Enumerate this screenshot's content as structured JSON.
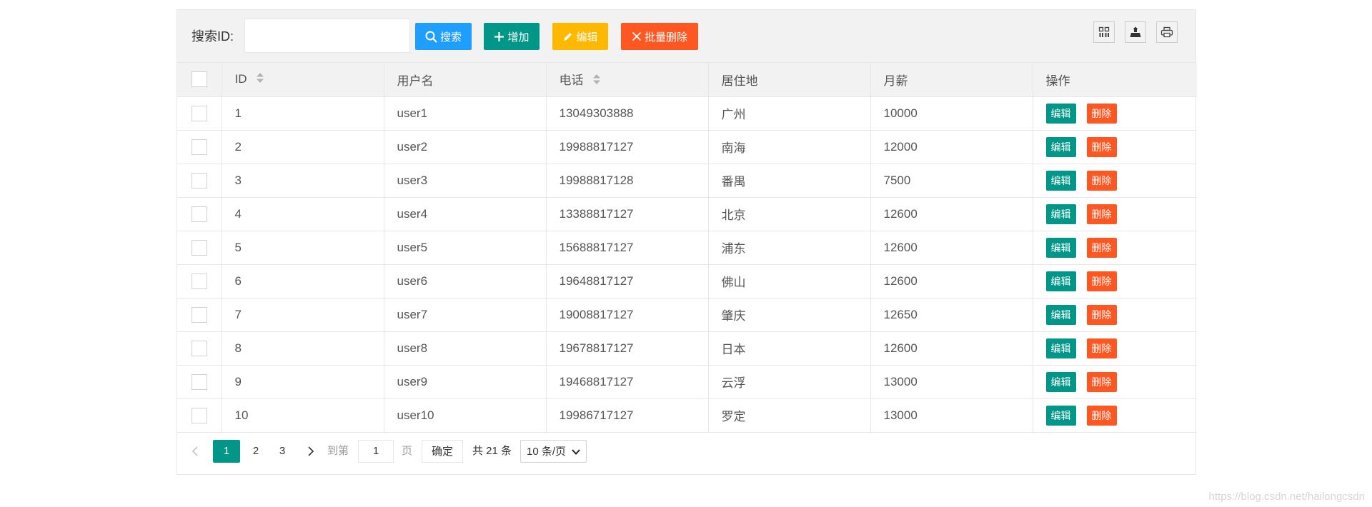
{
  "toolbar": {
    "search_label": "搜索ID:",
    "search_value": "",
    "search_button": "搜索",
    "add_button": "增加",
    "edit_button": "编辑",
    "batch_delete_button": "批量删除",
    "colors": {
      "search": "#1e9fff",
      "add": "#009688",
      "edit": "#ffb800",
      "batch_delete": "#ff5722"
    },
    "icons": [
      "columns-filter-icon",
      "export-icon",
      "print-icon"
    ]
  },
  "table": {
    "headers": {
      "id": "ID",
      "username": "用户名",
      "phone": "电话",
      "city": "居住地",
      "salary": "月薪",
      "actions": "操作"
    },
    "row_edit_label": "编辑",
    "row_delete_label": "删除",
    "rows": [
      {
        "id": "1",
        "username": "user1",
        "phone": "13049303888",
        "city": "广州",
        "salary": "10000"
      },
      {
        "id": "2",
        "username": "user2",
        "phone": "19988817127",
        "city": "南海",
        "salary": "12000"
      },
      {
        "id": "3",
        "username": "user3",
        "phone": "19988817128",
        "city": "番禺",
        "salary": "7500"
      },
      {
        "id": "4",
        "username": "user4",
        "phone": "13388817127",
        "city": "北京",
        "salary": "12600"
      },
      {
        "id": "5",
        "username": "user5",
        "phone": "15688817127",
        "city": "浦东",
        "salary": "12600"
      },
      {
        "id": "6",
        "username": "user6",
        "phone": "19648817127",
        "city": "佛山",
        "salary": "12600"
      },
      {
        "id": "7",
        "username": "user7",
        "phone": "19008817127",
        "city": "肇庆",
        "salary": "12650"
      },
      {
        "id": "8",
        "username": "user8",
        "phone": "19678817127",
        "city": "日本",
        "salary": "12600"
      },
      {
        "id": "9",
        "username": "user9",
        "phone": "19468817127",
        "city": "云浮",
        "salary": "13000"
      },
      {
        "id": "10",
        "username": "user10",
        "phone": "19986717127",
        "city": "罗定",
        "salary": "13000"
      }
    ]
  },
  "pagination": {
    "current_page": "1",
    "pages": [
      "2",
      "3"
    ],
    "goto_label": "到第",
    "goto_value": "1",
    "page_label": "页",
    "confirm_label": "确定",
    "total_text": "共 21 条",
    "page_size": "10 条/页"
  },
  "watermark": "https://blog.csdn.net/hailongcsdn"
}
